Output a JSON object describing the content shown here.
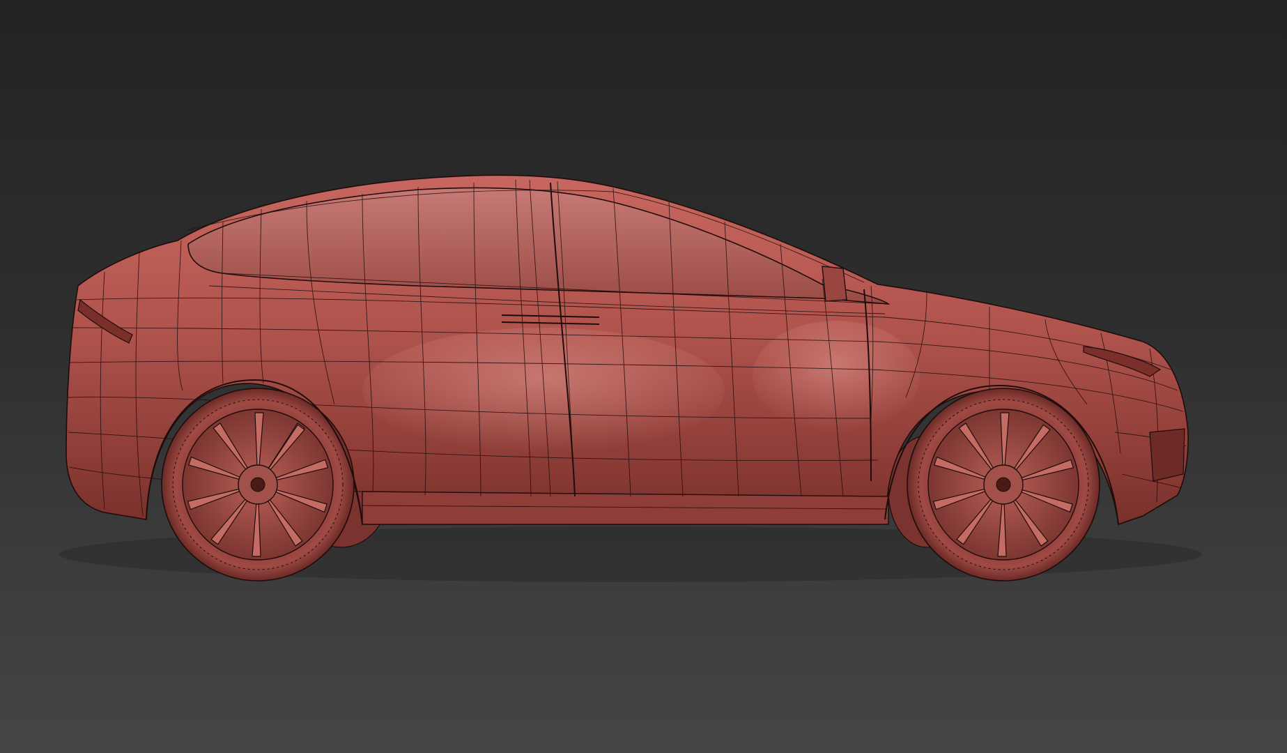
{
  "viewport": {
    "background_top": "#222222",
    "background_bottom": "#454545",
    "shading_mode": "shaded-with-wireframe"
  },
  "model": {
    "subject": "car-side-view",
    "body_color": "#b85a55",
    "body_highlight": "#d98a82",
    "body_shadow": "#6e2a26",
    "wire_color": "#1e0c0b",
    "wheel_spokes": 10
  }
}
